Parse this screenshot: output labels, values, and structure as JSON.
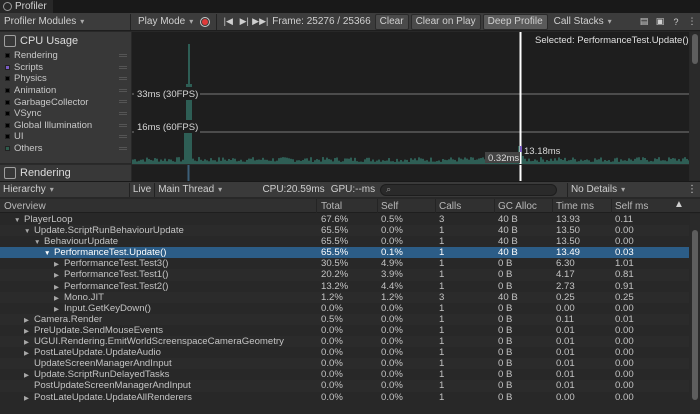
{
  "window": {
    "tab_title": "Profiler"
  },
  "toolbar": {
    "modules": "Profiler Modules",
    "play_mode": "Play Mode",
    "frame": "Frame: 25276 / 25366",
    "clear": "Clear",
    "clear_on_play": "Clear on Play",
    "deep_profile": "Deep Profile",
    "call_stacks": "Call Stacks"
  },
  "cpu_module": {
    "title": "CPU Usage",
    "categories": [
      {
        "label": "Rendering",
        "color": "#000000"
      },
      {
        "label": "Scripts",
        "color": "#7b5cc4"
      },
      {
        "label": "Physics",
        "color": "#000000"
      },
      {
        "label": "Animation",
        "color": "#000000"
      },
      {
        "label": "GarbageCollector",
        "color": "#000000"
      },
      {
        "label": "VSync",
        "color": "#000000"
      },
      {
        "label": "Global Illumination",
        "color": "#000000"
      },
      {
        "label": "UI",
        "color": "#000000"
      },
      {
        "label": "Others",
        "color": "#2e5e4e"
      }
    ],
    "graph": {
      "selected_label": "Selected: PerformanceTest.Update()",
      "line_30fps": "33ms (30FPS)",
      "line_60fps": "16ms (60FPS)",
      "marker_high": "13.18ms",
      "marker_low": "0.32ms",
      "series_color": "#2e5e55"
    }
  },
  "render_module": {
    "title": "Rendering"
  },
  "hierarchy_bar": {
    "view": "Hierarchy",
    "live": "Live",
    "thread": "Main Thread",
    "cpu": "CPU:20.59ms",
    "gpu": "GPU:--ms",
    "details": "No Details"
  },
  "columns": [
    "Overview",
    "Total",
    "Self",
    "Calls",
    "GC Alloc",
    "Time ms",
    "Self ms"
  ],
  "rows": [
    {
      "depth": 0,
      "arrow": "▼",
      "name": "PlayerLoop",
      "total": "67.6%",
      "self": "0.5%",
      "calls": "3",
      "gc": "40 B",
      "time": "13.93",
      "selfms": "0.11"
    },
    {
      "depth": 1,
      "arrow": "▼",
      "name": "Update.ScriptRunBehaviourUpdate",
      "total": "65.5%",
      "self": "0.0%",
      "calls": "1",
      "gc": "40 B",
      "time": "13.50",
      "selfms": "0.00"
    },
    {
      "depth": 2,
      "arrow": "▼",
      "name": "BehaviourUpdate",
      "total": "65.5%",
      "self": "0.0%",
      "calls": "1",
      "gc": "40 B",
      "time": "13.50",
      "selfms": "0.00"
    },
    {
      "depth": 3,
      "arrow": "▼",
      "name": "PerformanceTest.Update()",
      "total": "65.5%",
      "self": "0.1%",
      "calls": "1",
      "gc": "40 B",
      "time": "13.49",
      "selfms": "0.03",
      "selected": true
    },
    {
      "depth": 4,
      "arrow": "▶",
      "name": "PerformanceTest.Test3()",
      "total": "30.5%",
      "self": "4.9%",
      "calls": "1",
      "gc": "0 B",
      "time": "6.30",
      "selfms": "1.01"
    },
    {
      "depth": 4,
      "arrow": "▶",
      "name": "PerformanceTest.Test1()",
      "total": "20.2%",
      "self": "3.9%",
      "calls": "1",
      "gc": "0 B",
      "time": "4.17",
      "selfms": "0.81"
    },
    {
      "depth": 4,
      "arrow": "▶",
      "name": "PerformanceTest.Test2()",
      "total": "13.2%",
      "self": "4.4%",
      "calls": "1",
      "gc": "0 B",
      "time": "2.73",
      "selfms": "0.91"
    },
    {
      "depth": 4,
      "arrow": "▶",
      "name": "Mono.JIT",
      "total": "1.2%",
      "self": "1.2%",
      "calls": "3",
      "gc": "40 B",
      "time": "0.25",
      "selfms": "0.25"
    },
    {
      "depth": 4,
      "arrow": "▶",
      "name": "Input.GetKeyDown()",
      "total": "0.0%",
      "self": "0.0%",
      "calls": "1",
      "gc": "0 B",
      "time": "0.00",
      "selfms": "0.00"
    },
    {
      "depth": 1,
      "arrow": "▶",
      "name": "Camera.Render",
      "total": "0.5%",
      "self": "0.0%",
      "calls": "1",
      "gc": "0 B",
      "time": "0.11",
      "selfms": "0.01"
    },
    {
      "depth": 1,
      "arrow": "▶",
      "name": "PreUpdate.SendMouseEvents",
      "total": "0.0%",
      "self": "0.0%",
      "calls": "1",
      "gc": "0 B",
      "time": "0.01",
      "selfms": "0.00"
    },
    {
      "depth": 1,
      "arrow": "▶",
      "name": "UGUI.Rendering.EmitWorldScreenspaceCameraGeometry",
      "total": "0.0%",
      "self": "0.0%",
      "calls": "1",
      "gc": "0 B",
      "time": "0.01",
      "selfms": "0.00"
    },
    {
      "depth": 1,
      "arrow": "▶",
      "name": "PostLateUpdate.UpdateAudio",
      "total": "0.0%",
      "self": "0.0%",
      "calls": "1",
      "gc": "0 B",
      "time": "0.01",
      "selfms": "0.00"
    },
    {
      "depth": 1,
      "arrow": "",
      "name": "UpdateScreenManagerAndInput",
      "total": "0.0%",
      "self": "0.0%",
      "calls": "1",
      "gc": "0 B",
      "time": "0.01",
      "selfms": "0.00"
    },
    {
      "depth": 1,
      "arrow": "▶",
      "name": "Update.ScriptRunDelayedTasks",
      "total": "0.0%",
      "self": "0.0%",
      "calls": "1",
      "gc": "0 B",
      "time": "0.01",
      "selfms": "0.00"
    },
    {
      "depth": 1,
      "arrow": "",
      "name": "PostUpdateScreenManagerAndInput",
      "total": "0.0%",
      "self": "0.0%",
      "calls": "1",
      "gc": "0 B",
      "time": "0.01",
      "selfms": "0.00"
    },
    {
      "depth": 1,
      "arrow": "▶",
      "name": "PostLateUpdate.UpdateAllRenderers",
      "total": "0.0%",
      "self": "0.0%",
      "calls": "1",
      "gc": "0 B",
      "time": "0.00",
      "selfms": "0.00"
    }
  ]
}
